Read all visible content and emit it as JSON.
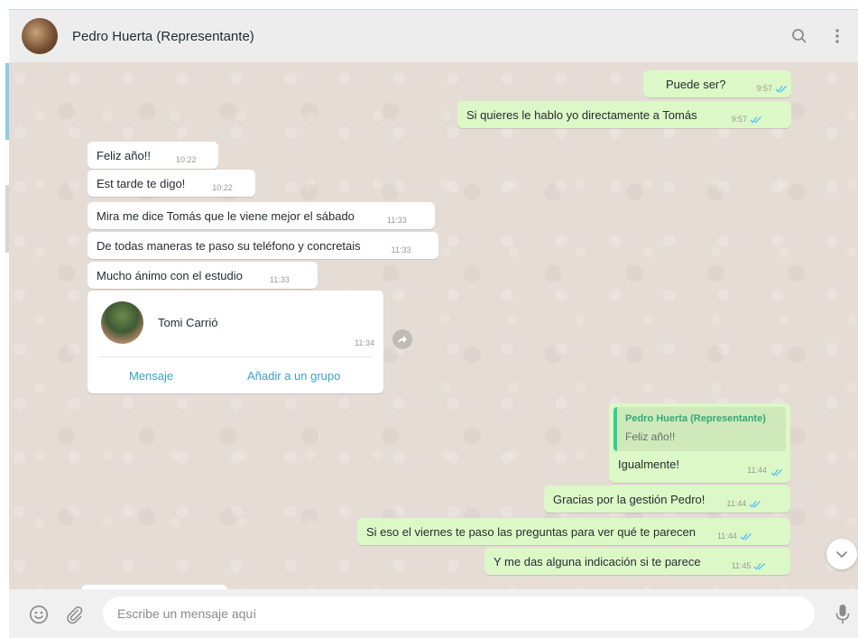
{
  "header": {
    "contact_name": "Pedro Huerta (Representante)"
  },
  "messages": {
    "m1": {
      "text": "Puede ser?",
      "time": "9:57"
    },
    "m2": {
      "text": "Si quieres le hablo yo directamente a Tomás",
      "time": "9:57"
    },
    "m3": {
      "text": "Feliz año!!",
      "time": "10:22"
    },
    "m4": {
      "text": "Est tarde te digo!",
      "time": "10:22"
    },
    "m5": {
      "text": "Mira me dice Tomás que le viene mejor el sábado",
      "time": "11:33"
    },
    "m6": {
      "text": "De todas maneras te paso su teléfono y concretais",
      "time": "11:33"
    },
    "m7": {
      "text": "Mucho ánimo con el estudio",
      "time": "11:33"
    },
    "contact_card": {
      "name": "Tomi Carrió",
      "time": "11:34",
      "message_button": "Mensaje",
      "add_group_button": "Añadir a un grupo"
    },
    "reply": {
      "quoted_author": "Pedro Huerta (Representante)",
      "quoted_text": "Feliz año!!",
      "text": "Igualmente!",
      "time": "11:44"
    },
    "m9": {
      "text": "Gracias por la gestión Pedro!",
      "time": "11:44"
    },
    "m10": {
      "text": "Si eso el viernes te paso las preguntas para ver qué te parecen",
      "time": "11:44"
    },
    "m11": {
      "text": "Y me das alguna indicación si te parece",
      "time": "11:45"
    }
  },
  "composer": {
    "placeholder": "Escribe un mensaje aquí"
  },
  "icons": {
    "search": "search-icon",
    "menu": "more-vertical-icon",
    "emoji": "emoji-icon",
    "attach": "paperclip-icon",
    "mic": "microphone-icon",
    "forward": "forward-icon",
    "scroll_down": "chevron-down-icon",
    "read_receipt": "double-check-icon"
  },
  "colors": {
    "incoming_bubble": "#ffffff",
    "outgoing_bubble": "#dcf8c6",
    "chat_background": "#e5ddd5",
    "read_ticks": "#4fc3f7",
    "link": "#3aa0d0",
    "quote_accent": "#35cd96"
  }
}
